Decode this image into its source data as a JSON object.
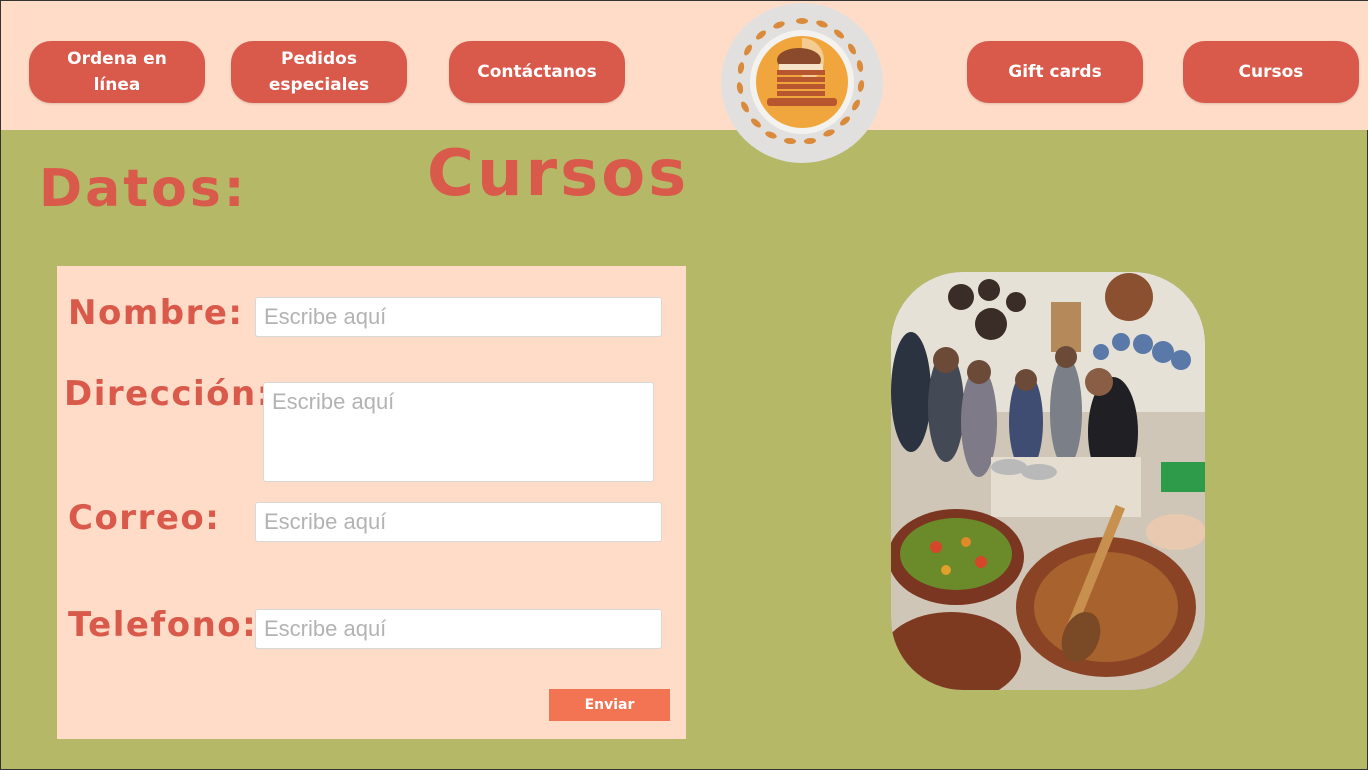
{
  "header": {
    "nav_left": [
      {
        "label": "Ordena en línea"
      },
      {
        "label": "Pedidos especiales"
      },
      {
        "label": "Contáctanos"
      }
    ],
    "nav_right": [
      {
        "label": "Gift cards"
      },
      {
        "label": "Cursos"
      }
    ],
    "logo_icon": "bakery-logo-icon"
  },
  "page": {
    "section_title": "Datos:",
    "page_title": "Cursos"
  },
  "form": {
    "name_label": "Nombre:",
    "name_placeholder": "Escribe aquí",
    "address_label": "Dirección:",
    "address_placeholder": "Escribe aquí",
    "email_label": "Correo:",
    "email_placeholder": "Escribe aquí",
    "phone_label": "Telefono:",
    "phone_placeholder": "Escribe aquí",
    "submit_label": "Enviar"
  },
  "colors": {
    "background": "#b5b866",
    "header": "#ffdcc8",
    "accent": "#d9594b",
    "submit": "#f27452"
  }
}
